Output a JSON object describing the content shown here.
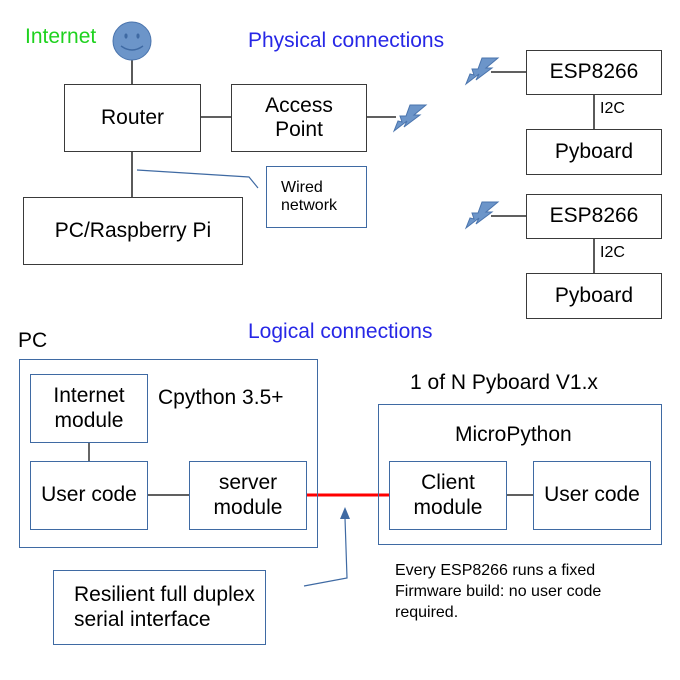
{
  "colors": {
    "internet_label": "#1fd21f",
    "section_heading": "#2727e6",
    "smiley_fill": "#6c95c9",
    "wireless_icon": "#6c95c9",
    "logical_border": "#3f6aa3",
    "serial_link": "#ff0000"
  },
  "physical": {
    "heading": "Physical connections",
    "internet_label": "Internet",
    "router": "Router",
    "access_point": "Access\nPoint",
    "pc_raspberry": "PC/Raspberry Pi",
    "wired_callout": "Wired\nnetwork",
    "nodes": [
      {
        "esp": "ESP8266",
        "bus": "I2C",
        "board": "Pyboard"
      },
      {
        "esp": "ESP8266",
        "bus": "I2C",
        "board": "Pyboard"
      }
    ]
  },
  "logical": {
    "heading": "Logical connections",
    "pc_label": "PC",
    "pc_runtime": "Cpython 3.5+",
    "internet_module": "Internet\nmodule",
    "pc_user_code": "User code",
    "server_module": "server\nmodule",
    "pyboard_label": "1 of N Pyboard V1.x",
    "pyboard_runtime": "MicroPython",
    "client_module": "Client\nmodule",
    "pyboard_user_code": "User code",
    "serial_callout": "Resilient full duplex\nserial interface",
    "note": "Every ESP8266 runs a fixed\nFirmware build: no user code\nrequired."
  }
}
